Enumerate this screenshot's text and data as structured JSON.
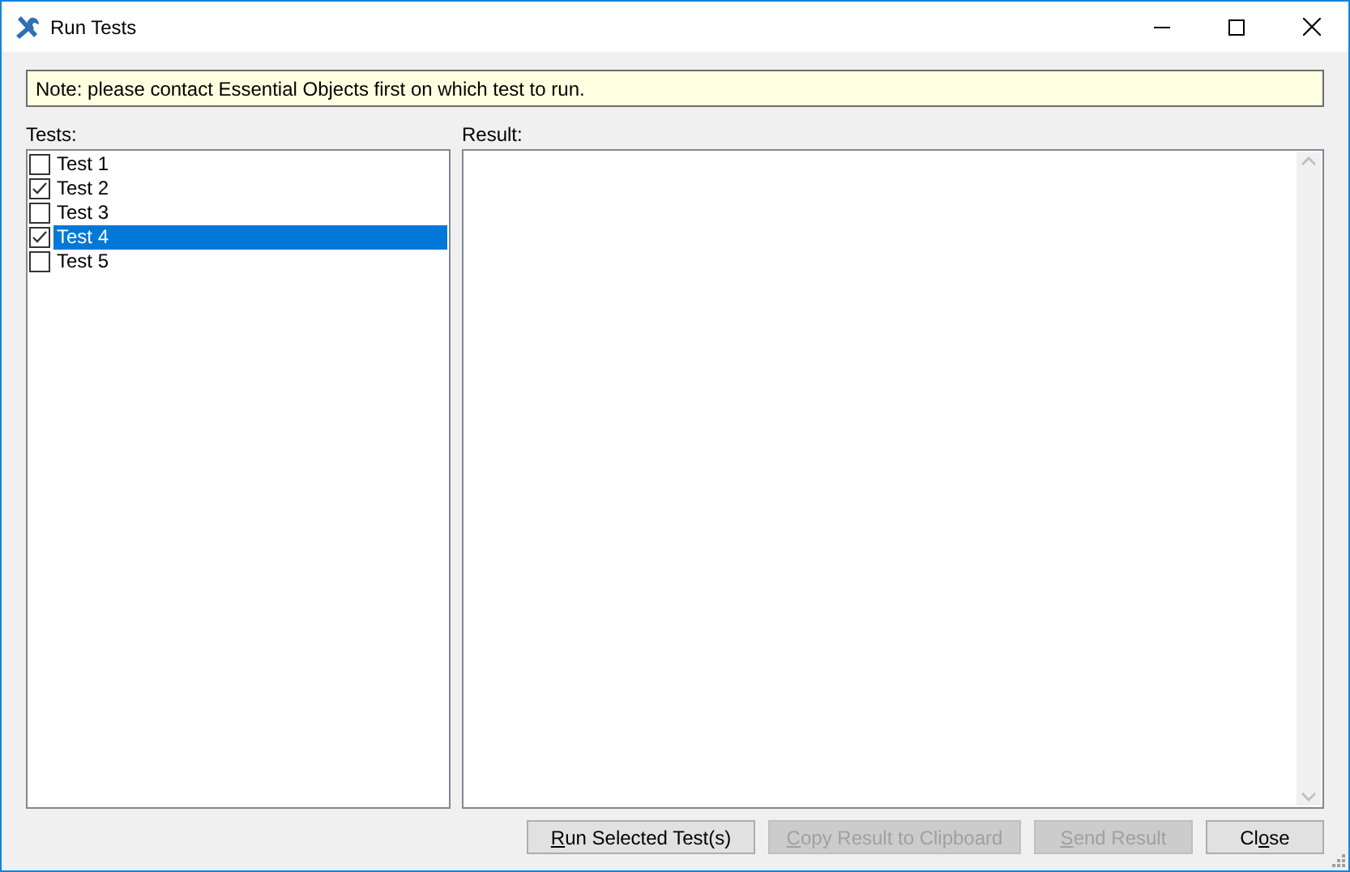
{
  "window": {
    "title": "Run Tests"
  },
  "note": "Note: please contact Essential Objects first on which test to run.",
  "tests_label": "Tests:",
  "tests": [
    {
      "label": "Test 1",
      "checked": false,
      "selected": false
    },
    {
      "label": "Test 2",
      "checked": true,
      "selected": false
    },
    {
      "label": "Test 3",
      "checked": false,
      "selected": false
    },
    {
      "label": "Test 4",
      "checked": true,
      "selected": true
    },
    {
      "label": "Test 5",
      "checked": false,
      "selected": false
    }
  ],
  "result_label": "Result:",
  "buttons": [
    {
      "key": "R",
      "after": "un Selected Test(s)",
      "disabled": false
    },
    {
      "key": "C",
      "after": "opy Result to Clipboard",
      "disabled": true
    },
    {
      "key": "S",
      "after": "end Result",
      "disabled": true
    },
    {
      "before": "Cl",
      "key": "o",
      "after": "se",
      "disabled": false
    }
  ]
}
